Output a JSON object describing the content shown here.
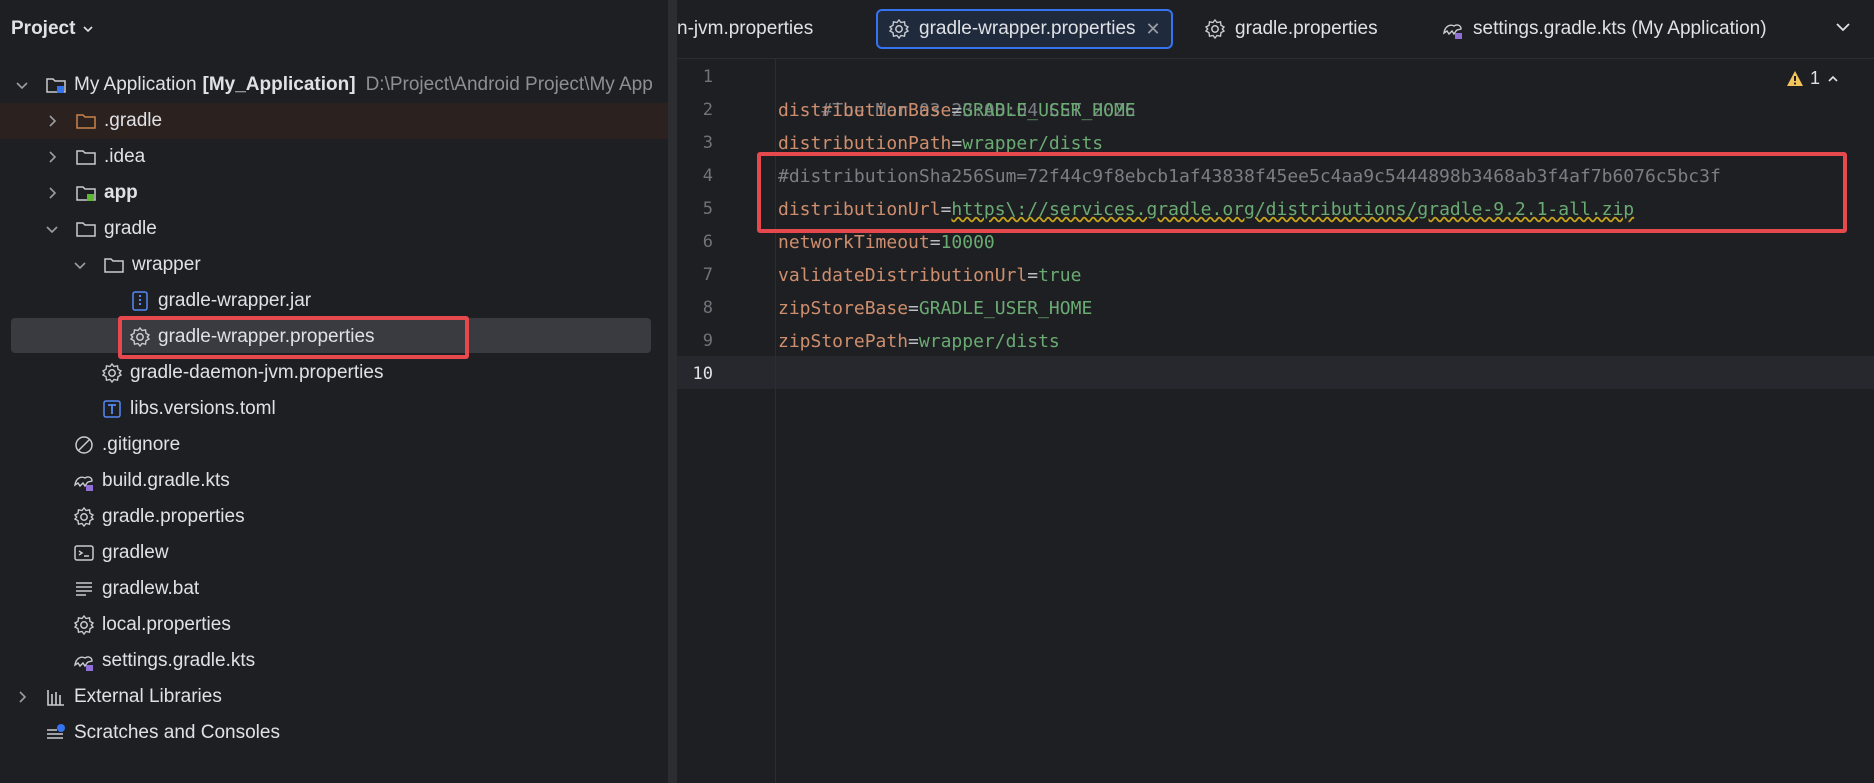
{
  "project_panel": {
    "title": "Project",
    "root": {
      "name": "My Application",
      "module": "[My_Application]",
      "path": "D:\\Project\\Android Project\\My App"
    },
    "items": [
      {
        "label": ".gradle"
      },
      {
        "label": ".idea"
      },
      {
        "label": "app"
      },
      {
        "label": "gradle"
      },
      {
        "label": "wrapper"
      },
      {
        "label": "gradle-wrapper.jar"
      },
      {
        "label": "gradle-wrapper.properties"
      },
      {
        "label": "gradle-daemon-jvm.properties"
      },
      {
        "label": "libs.versions.toml"
      },
      {
        "label": ".gitignore"
      },
      {
        "label": "build.gradle.kts"
      },
      {
        "label": "gradle.properties"
      },
      {
        "label": "gradlew"
      },
      {
        "label": "gradlew.bat"
      },
      {
        "label": "local.properties"
      },
      {
        "label": "settings.gradle.kts"
      },
      {
        "label": "External Libraries"
      },
      {
        "label": "Scratches and Consoles"
      }
    ]
  },
  "tabs": [
    {
      "label": "n-jvm.properties"
    },
    {
      "label": "gradle-wrapper.properties",
      "active": true
    },
    {
      "label": "gradle.properties"
    },
    {
      "label": "settings.gradle.kts (My Application)"
    }
  ],
  "editor": {
    "warning_count": "1",
    "line_numbers": [
      "1",
      "2",
      "3",
      "4",
      "5",
      "6",
      "7",
      "8",
      "9",
      "10"
    ],
    "lines": [
      {
        "comment": "#Tue Mar 03 23:08:04 CST 2026"
      },
      {
        "key": "distributionBase",
        "eq": "=",
        "value": "GRADLE_USER_HOME"
      },
      {
        "key": "distributionPath",
        "eq": "=",
        "value": "wrapper/dists"
      },
      {
        "comment": "#distributionSha256Sum=72f44c9f8ebcb1af43838f45ee5c4aa9c5444898b3468ab3f4af7b6076c5bc3f"
      },
      {
        "key": "distributionUrl",
        "eq": "=",
        "value": "https\\://services.gradle.org/distributions/gradle-9.2.1-all.zip"
      },
      {
        "key": "networkTimeout",
        "eq": "=",
        "value": "10000"
      },
      {
        "key": "validateDistributionUrl",
        "eq": "=",
        "value": "true"
      },
      {
        "key": "zipStoreBase",
        "eq": "=",
        "value": "GRADLE_USER_HOME"
      },
      {
        "key": "zipStorePath",
        "eq": "=",
        "value": "wrapper/dists"
      }
    ]
  },
  "colors": {
    "background": "#1e1f22",
    "selection": "#393b40",
    "highlight_box": "#e5484d",
    "active_tab_border": "#3574f0",
    "key": "#cf8e6d",
    "value": "#6aab73",
    "comment": "#7a7e85"
  }
}
